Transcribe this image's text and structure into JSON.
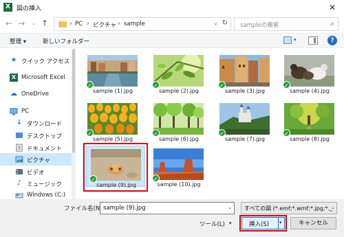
{
  "window": {
    "title": "図の挿入",
    "app_icon": "X"
  },
  "nav": {
    "back_icon": "arrow-left-icon",
    "forward_icon": "arrow-right-icon",
    "up_icon": "arrow-up-icon",
    "breadcrumbs": [
      "PC",
      "ピクチャ",
      "sample"
    ],
    "search_placeholder": "sampleの検索"
  },
  "toolbar": {
    "organize": "整理 ▾",
    "new_folder": "新しいフォルダー"
  },
  "sidebar": {
    "items": [
      {
        "label": "クイック アクセス",
        "icon": "star-icon"
      },
      {
        "label": "Microsoft Excel",
        "icon": "excel-icon"
      },
      {
        "label": "OneDrive",
        "icon": "cloud-icon"
      },
      {
        "label": "PC",
        "icon": "computer-icon"
      },
      {
        "label": "ダウンロード",
        "icon": "download-icon"
      },
      {
        "label": "デスクトップ",
        "icon": "desktop-icon"
      },
      {
        "label": "ドキュメント",
        "icon": "document-icon"
      },
      {
        "label": "ピクチャ",
        "icon": "pictures-icon",
        "selected": true
      },
      {
        "label": "ビデオ",
        "icon": "video-icon"
      },
      {
        "label": "ミュージック",
        "icon": "music-icon"
      },
      {
        "label": "Windows (C:)",
        "icon": "drive-icon"
      }
    ]
  },
  "files": [
    {
      "name": "sample (1).jpg",
      "subject": "canal city"
    },
    {
      "name": "sample (2).jpg",
      "subject": "green leaves"
    },
    {
      "name": "sample (3).jpg",
      "subject": "old town street"
    },
    {
      "name": "sample (4).jpg",
      "subject": "ducks"
    },
    {
      "name": "sample (5).jpg",
      "subject": "tulips"
    },
    {
      "name": "sample (6).jpg",
      "subject": "forest"
    },
    {
      "name": "sample (7).jpg",
      "subject": "castle"
    },
    {
      "name": "sample (8).jpg",
      "subject": "tree path"
    },
    {
      "name": "sample (9).jpg",
      "subject": "hermit crab",
      "selected": true
    },
    {
      "name": "sample (10).jpg",
      "subject": "desert"
    }
  ],
  "footer": {
    "filename_label": "ファイル名(N):",
    "filename_value": "sample (9).jpg",
    "filetype_value": "すべての図 (*.emf;*.wmf;*.jpg;*.jj",
    "tools_label": "ツール(L)",
    "insert_label": "挿入(S)",
    "cancel_label": "キャンセル"
  },
  "colors": {
    "accent": "#0078d7",
    "selection": "#cce8ff",
    "highlight_outline": "#e1000f",
    "check": "#2a9d3a"
  }
}
